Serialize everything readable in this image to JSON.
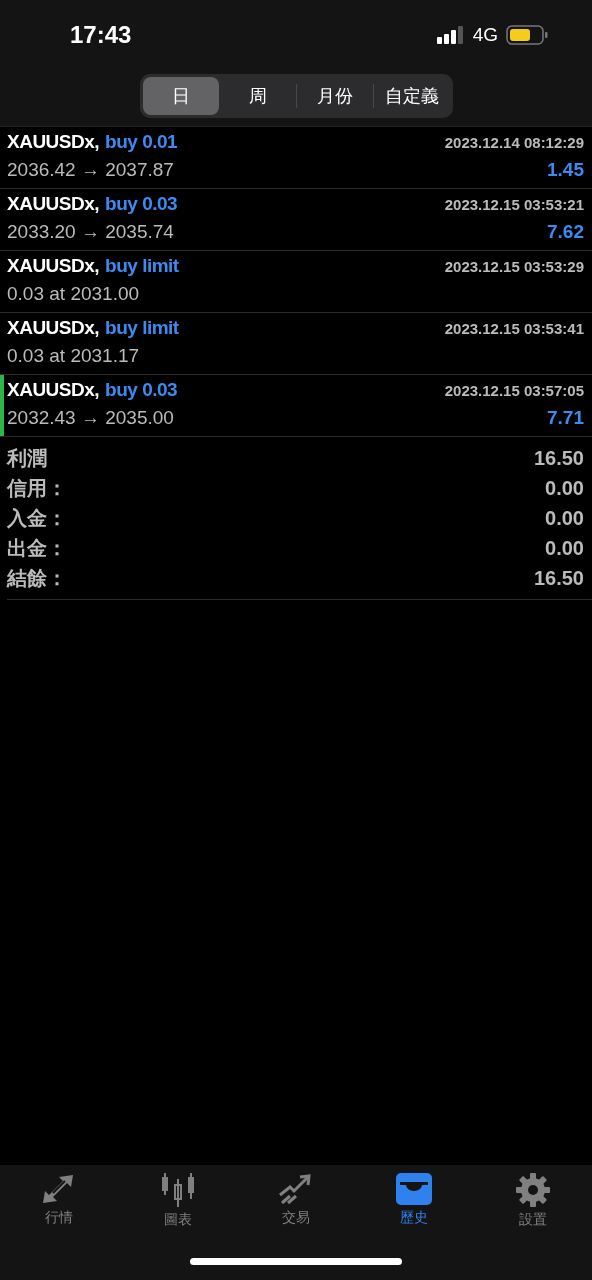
{
  "status_bar": {
    "time": "17:43",
    "network": "4G"
  },
  "tabs": [
    {
      "label": "日",
      "selected": true
    },
    {
      "label": "周",
      "selected": false
    },
    {
      "label": "月份",
      "selected": false
    },
    {
      "label": "自定義",
      "selected": false
    }
  ],
  "deals": [
    {
      "symbol": "XAUUSDx,",
      "action": "buy 0.01",
      "time": "2023.12.14 08:12:29",
      "detail": "2036.42 → 2037.87",
      "profit": "1.45",
      "highlighted": false
    },
    {
      "symbol": "XAUUSDx,",
      "action": "buy 0.03",
      "time": "2023.12.15 03:53:21",
      "detail": "2033.20 → 2035.74",
      "profit": "7.62",
      "highlighted": false
    },
    {
      "symbol": "XAUUSDx,",
      "action": "buy limit",
      "time": "2023.12.15 03:53:29",
      "detail": "0.03 at 2031.00",
      "highlighted": false
    },
    {
      "symbol": "XAUUSDx,",
      "action": "buy limit",
      "time": "2023.12.15 03:53:41",
      "detail": "0.03 at 2031.17",
      "highlighted": false
    },
    {
      "symbol": "XAUUSDx,",
      "action": "buy 0.03",
      "time": "2023.12.15 03:57:05",
      "detail": "2032.43 → 2035.00",
      "profit": "7.71",
      "highlighted": true
    }
  ],
  "summary": [
    {
      "label": "利潤",
      "value": "16.50"
    },
    {
      "label": "信用：",
      "value": "0.00"
    },
    {
      "label": "入金：",
      "value": "0.00"
    },
    {
      "label": "出金：",
      "value": "0.00"
    },
    {
      "label": "結餘：",
      "value": "16.50"
    }
  ],
  "nav": [
    {
      "kind": "quotes",
      "label": "行情",
      "selected": false
    },
    {
      "kind": "chart",
      "label": "圖表",
      "selected": false
    },
    {
      "kind": "trade",
      "label": "交易",
      "selected": false
    },
    {
      "kind": "history",
      "label": "歷史",
      "selected": true
    },
    {
      "kind": "settings",
      "label": "設置",
      "selected": false
    }
  ]
}
